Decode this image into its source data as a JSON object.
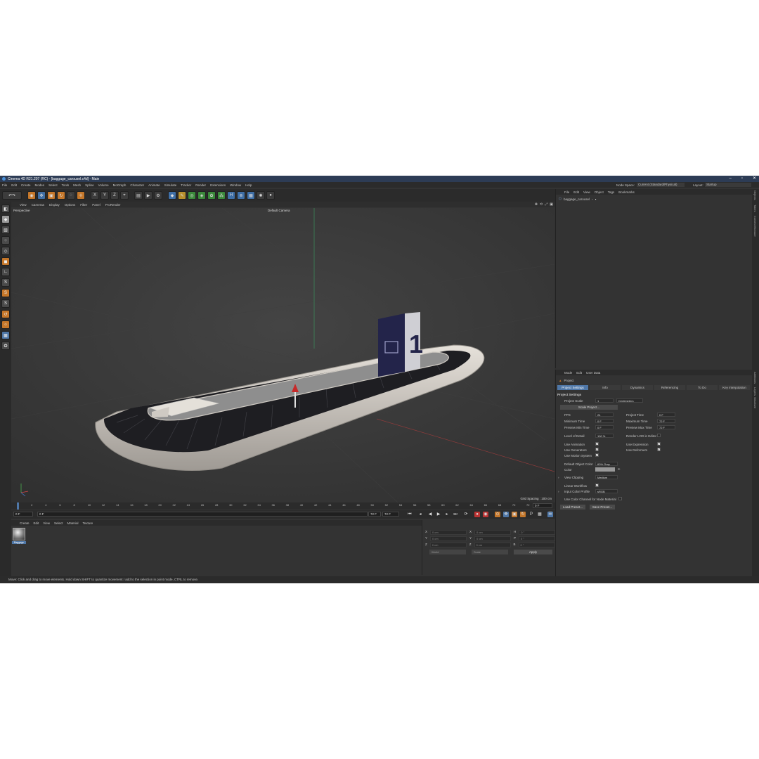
{
  "titlebar": {
    "title": "Cinema 4D R21.207 (RC) - [baggage_carousel.c4d] - Main"
  },
  "menus": [
    "File",
    "Edit",
    "Create",
    "Modes",
    "Select",
    "Tools",
    "Mesh",
    "Spline",
    "Volume",
    "MoGraph",
    "Character",
    "Animate",
    "Simulate",
    "Tracker",
    "Render",
    "Extensions",
    "Window",
    "Help"
  ],
  "topright": {
    "node_space_label": "Node Space:",
    "node_space_value": "Current (Standard/Physical)",
    "layout_label": "Layout:",
    "layout_value": "Startup"
  },
  "viewport": {
    "menu": [
      "View",
      "Cameras",
      "Display",
      "Options",
      "Filter",
      "Panel",
      "ProRender"
    ],
    "label": "Perspective",
    "camera": "Default Camera",
    "grid": "Grid Spacing : 100 cm",
    "sign_number": "1"
  },
  "timeline": {
    "ticks": [
      "0",
      "2",
      "4",
      "6",
      "8",
      "10",
      "12",
      "14",
      "16",
      "18",
      "20",
      "22",
      "24",
      "26",
      "28",
      "30",
      "32",
      "34",
      "36",
      "38",
      "40",
      "42",
      "44",
      "46",
      "48",
      "50",
      "52",
      "54",
      "56",
      "58",
      "60",
      "62",
      "64",
      "66",
      "68",
      "70",
      "72"
    ],
    "end_field": "0 F",
    "start_value": "0 F",
    "current_value": "0 F",
    "end_value": "72 F",
    "max_value": "72 F"
  },
  "materials": {
    "menu": [
      "Create",
      "Edit",
      "View",
      "Select",
      "Material",
      "Texture"
    ],
    "item": "Baggage"
  },
  "coords": {
    "x1": "0 cm",
    "y1": "0 cm",
    "z1": "0 cm",
    "x2": "0 cm",
    "y2": "0 cm",
    "z2": "0 cm",
    "h": "0 °",
    "p": "0 °",
    "b": "0 °",
    "mode1": "World",
    "mode2": "Scale",
    "apply": "Apply",
    "labels": [
      "X",
      "Y",
      "Z",
      "X",
      "Y",
      "Z",
      "H",
      "P",
      "B"
    ]
  },
  "objects": {
    "menu": [
      "File",
      "Edit",
      "View",
      "Object",
      "Tags",
      "Bookmarks"
    ],
    "item": "baggage_carousel"
  },
  "attributes": {
    "menu": [
      "Mode",
      "Edit",
      "User Data"
    ],
    "header": "Project",
    "tabs": [
      "Project Settings",
      "Info",
      "Dynamics",
      "Referencing",
      "To Do",
      "Key Interpolation"
    ],
    "section": "Project Settings",
    "project_scale_label": "Project Scale",
    "project_scale_value": "1",
    "project_scale_unit": "Centimeters",
    "scale_btn": "Scale Project...",
    "fps_label": "FPS",
    "fps": "24",
    "project_time_label": "Project Time",
    "project_time": "0 F",
    "min_time_label": "Minimum Time",
    "min_time": "0 F",
    "max_time_label": "Maximum Time",
    "max_time": "72 F",
    "prev_min_label": "Preview Min Time",
    "prev_min": "0 F",
    "prev_max_label": "Preview Max Time",
    "prev_max": "72 F",
    "lod_label": "Level of Detail",
    "lod": "100 %",
    "render_lod_label": "Render LOD in Editor",
    "use_anim": "Use Animation",
    "use_expr": "Use Expression",
    "use_gen": "Use Generators",
    "use_def": "Use Deformers",
    "use_motion": "Use Motion System",
    "def_color_label": "Default Object Color",
    "def_color": "60% Gray",
    "color_label": "Color",
    "view_clip_label": "View Clipping",
    "view_clip": "Medium",
    "linear_label": "Linear Workflow",
    "input_profile_label": "Input Color Profile",
    "input_profile": "sRGB",
    "node_mat_label": "Use Color Channel for Node Material",
    "load_btn": "Load Preset...",
    "save_btn": "Save Preset..."
  },
  "side_tabs": [
    "Objects",
    "Takes",
    "Content Browser",
    "Attributes",
    "Layers",
    "Structure"
  ],
  "status": "Move: Click and drag to move elements. Hold down SHIFT to quantize movement / add to the selection in point mode, CTRL to remove."
}
